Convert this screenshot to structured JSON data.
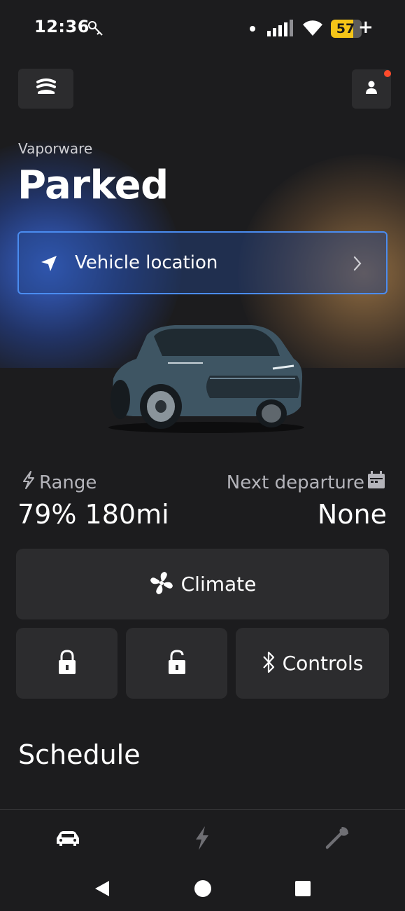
{
  "status_bar": {
    "time": "12:36",
    "battery": "57",
    "charging_symbol": "+",
    "icons": [
      "key-icon",
      "dot-icon",
      "signal-icon",
      "wifi-icon",
      "battery-icon"
    ]
  },
  "header": {
    "menu_icon": "car-stack-icon",
    "profile_icon": "person-icon",
    "has_notification": true
  },
  "vehicle": {
    "name": "Vaporware",
    "status": "Parked"
  },
  "location_button": {
    "label": "Vehicle location",
    "icon": "navigation-arrow-icon"
  },
  "stats": {
    "range_label": "Range",
    "range_value": "79% 180mi",
    "departure_label": "Next departure",
    "departure_value": "None"
  },
  "actions": {
    "climate_label": "Climate",
    "lock_icon": "lock-icon",
    "unlock_icon": "unlock-icon",
    "controls_label": "Controls"
  },
  "schedule": {
    "heading": "Schedule"
  },
  "bottom_nav": {
    "items": [
      "car-icon",
      "charge-icon",
      "wrench-icon"
    ],
    "active": "car-icon"
  },
  "colors": {
    "background": "#1c1c1e",
    "tile": "#2c2c2e",
    "accent_blue": "#4a8cf0",
    "battery_yellow": "#f5c518",
    "notification": "#ff4b2b"
  }
}
